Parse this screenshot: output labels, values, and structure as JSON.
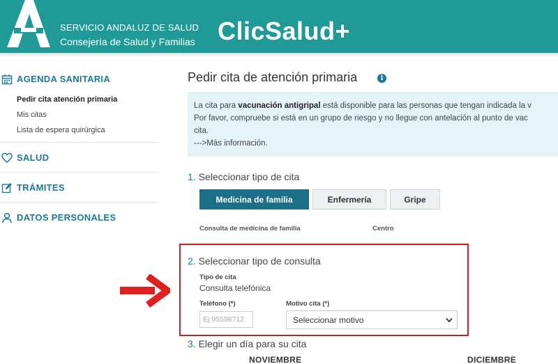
{
  "header": {
    "org_line1": "SERVICIO ANDALUZ DE SALUD",
    "org_line2": "Consejería de Salud y Familias",
    "brand": "ClicSalud+",
    "logo_icon": "junta-andalucia-logo-icon"
  },
  "sidebar": {
    "agenda": {
      "label": "AGENDA SANITARIA",
      "icon": "calendar-icon",
      "items": [
        {
          "label": "Pedir cita atención primaria",
          "active": true
        },
        {
          "label": "Mis citas",
          "active": false
        },
        {
          "label": "Lista de espera quirúrgica",
          "active": false
        }
      ]
    },
    "salud": {
      "label": "SALUD",
      "icon": "heart-icon"
    },
    "tramites": {
      "label": "TRÁMITES",
      "icon": "edit-icon"
    },
    "datos": {
      "label": "DATOS PERSONALES",
      "icon": "user-icon"
    }
  },
  "main": {
    "title": "Pedir cita de atención primaria",
    "info_icon": "i",
    "notice": {
      "line1_pre": "La cita para ",
      "line1_bold": "vacunación antigripal",
      "line1_post": " está disponible para las personas que tengan indicada la v",
      "line2": "Por favor, compruebe si está en un grupo de riesgo y no llegue con antelación al punto de vac",
      "line3": "cita.",
      "link": "--->Más información."
    },
    "step1": {
      "num": "1.",
      "label": "Seleccionar tipo de cita",
      "tabs": [
        {
          "label": "Medicina de familia",
          "active": true
        },
        {
          "label": "Enfermería",
          "active": false
        },
        {
          "label": "Gripe",
          "active": false
        }
      ],
      "col_consulta": "Consulta de medicina de familia",
      "col_centro": "Centro"
    },
    "step2": {
      "num": "2.",
      "label": "Seleccionar tipo de consulta",
      "tipo_label": "Tipo de cita",
      "tipo_value": "Consulta telefónica",
      "telefono_label": "Teléfono (*)",
      "telefono_placeholder": "Ej:95598712",
      "motivo_label": "Motivo cita (*)",
      "motivo_value": "Seleccionar motivo"
    },
    "step3": {
      "num": "3.",
      "label": "Elegir un día para su cita",
      "months": [
        "NOVIEMBRE",
        "DICIEMBRE"
      ]
    }
  },
  "colors": {
    "header_bg": "#1f9a97",
    "accent": "#1b7a93",
    "active_tab": "#1b6f86",
    "notice_bg": "#e3f3f6",
    "highlight": "#d11c1c"
  }
}
